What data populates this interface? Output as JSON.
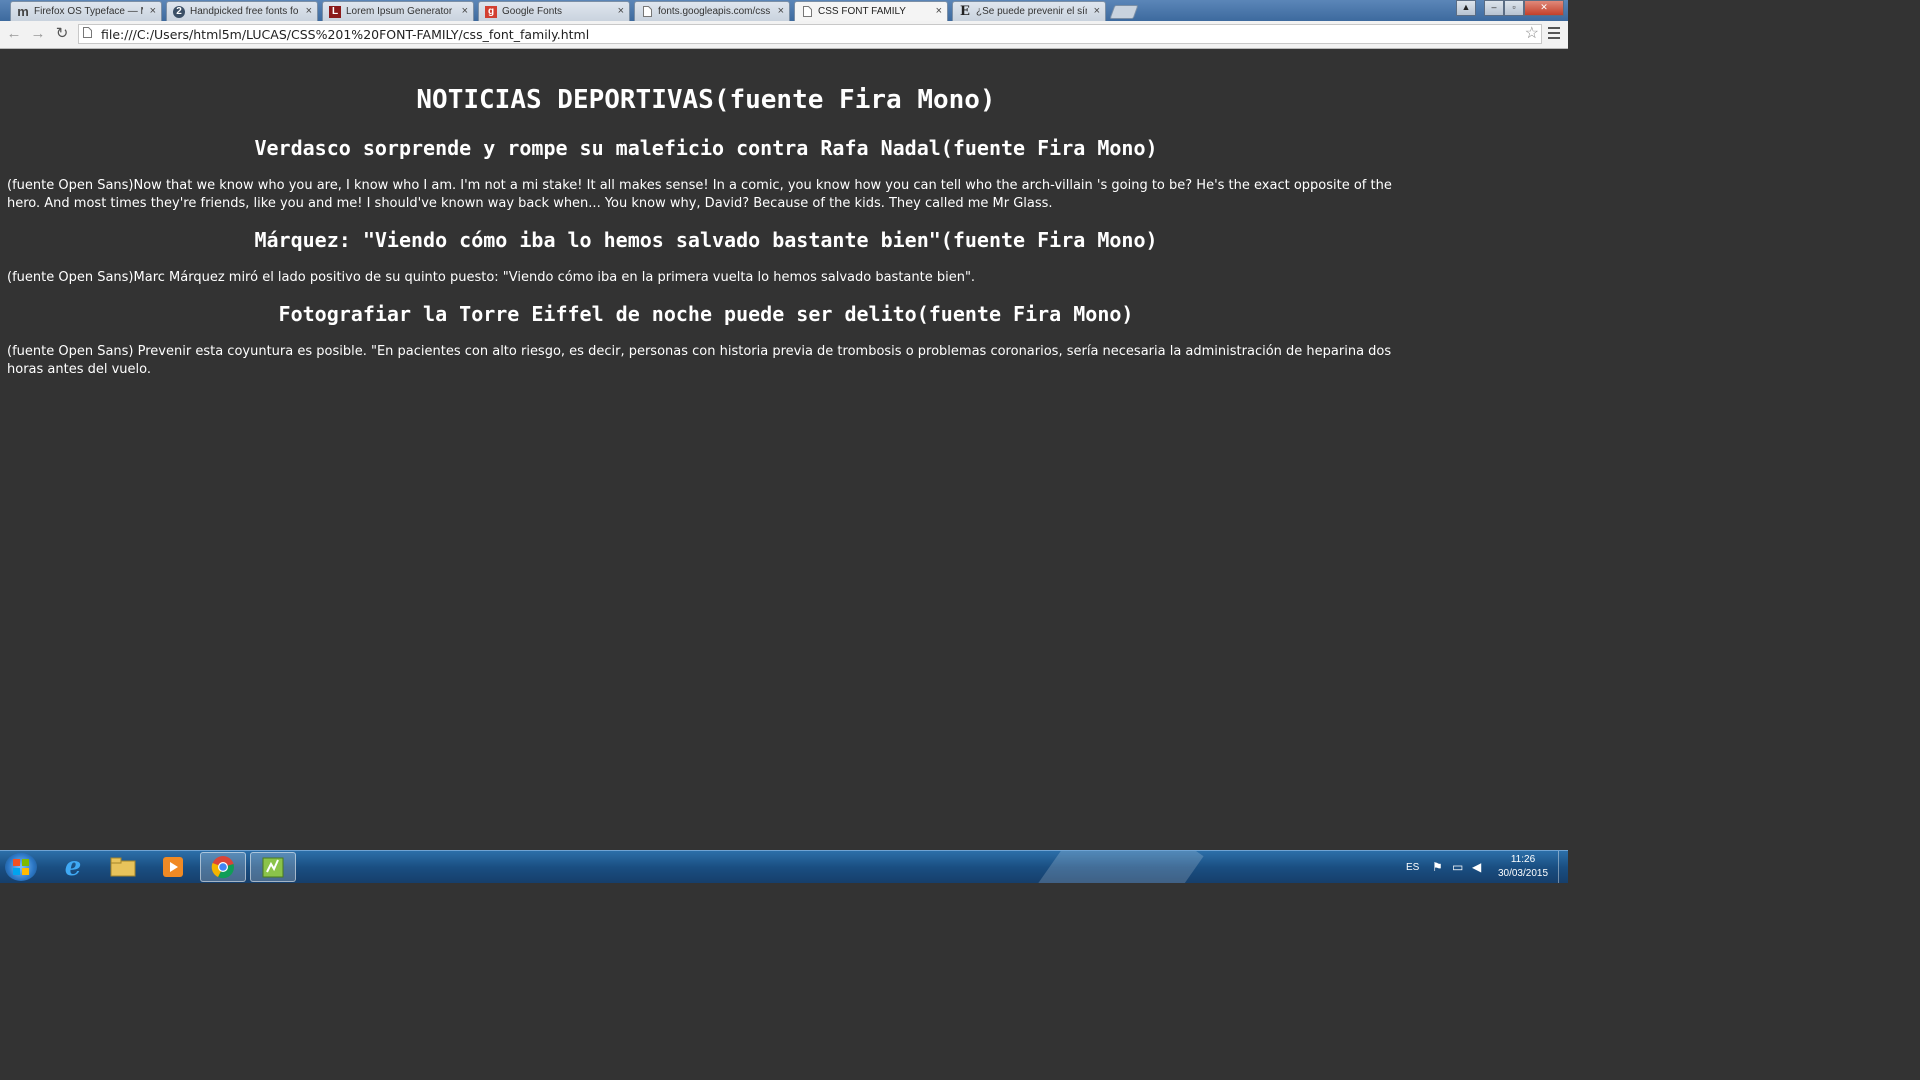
{
  "browser": {
    "tabs": [
      {
        "favicon": "m",
        "title": "Firefox OS Typeface — M"
      },
      {
        "favicon": "2",
        "title": "Handpicked free fonts for"
      },
      {
        "favicon": "L",
        "title": "Lorem Ipsum Generator -"
      },
      {
        "favicon": "g",
        "title": "Google Fonts"
      },
      {
        "favicon": "doc-icon",
        "title": "fonts.googleapis.com/css"
      },
      {
        "favicon": "doc-icon",
        "title": "CSS FONT FAMILY"
      },
      {
        "favicon": "E",
        "title": "¿Se puede prevenir el sínd"
      }
    ],
    "active_tab": 5,
    "url": "file:///C:/Users/html5m/LUCAS/CSS%201%20FONT-FAMILY/css_font_family.html"
  },
  "page": {
    "title": "NOTICIAS DEPORTIVAS(fuente Fira Mono)",
    "articles": [
      {
        "heading": "Verdasco sorprende y rompe su maleficio contra Rafa Nadal(fuente Fira Mono)",
        "body": "(fuente Open Sans)Now that we know who you are, I know who I am. I'm not a mi stake! It all makes sense! In a comic, you know how you can tell who the arch-villain 's going to be? He's the exact opposite of the hero. And most times they're friends, like you and me! I should've known way back when... You know why, David? Because of the kids. They called me Mr Glass."
      },
      {
        "heading": "Márquez: \"Viendo cómo iba lo hemos salvado bastante bien\"(fuente Fira Mono)",
        "body": "(fuente Open Sans)Marc Márquez miró el lado positivo de su quinto puesto: \"Viendo cómo iba en la primera vuelta lo hemos salvado bastante bien\"."
      },
      {
        "heading": "Fotografiar la Torre Eiffel de noche puede ser delito(fuente Fira Mono)",
        "body": "(fuente Open Sans) Prevenir esta coyuntura es posible. \"En pacientes con alto riesgo, es decir, personas con historia previa de trombosis o problemas coronarios, sería necesaria la administración de heparina dos horas antes del vuelo."
      }
    ]
  },
  "taskbar": {
    "language": "ES",
    "time": "11:26",
    "date": "30/03/2015"
  },
  "colors": {
    "page_background": "#333333",
    "page_text": "#ffffff",
    "taskbar": "#1a4f82"
  }
}
